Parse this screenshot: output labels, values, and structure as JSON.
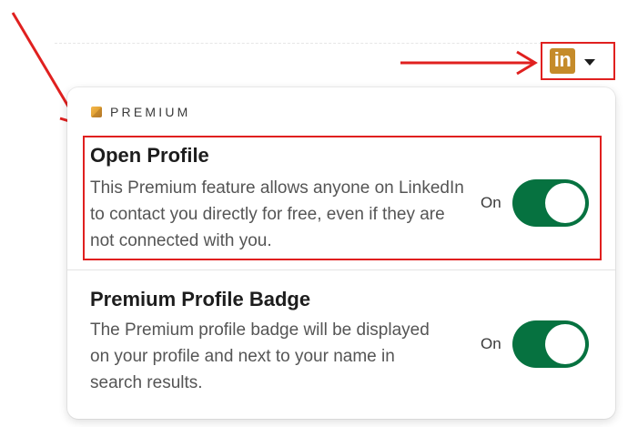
{
  "colors": {
    "annotation_red": "#e0201f",
    "premium_gold": "#c58b2a",
    "toggle_on": "#067240"
  },
  "trigger": {
    "logo_text": "in",
    "caret_icon": "chevron-down-icon"
  },
  "panel": {
    "section_label": "PREMIUM",
    "settings": [
      {
        "title": "Open Profile",
        "description": "This Premium feature allows anyone on LinkedIn to contact you directly for free, even if they are not connected with you.",
        "state_label": "On",
        "enabled": true
      },
      {
        "title": "Premium Profile Badge",
        "description": "The Premium profile badge will be displayed on your profile and next to your name in search results.",
        "state_label": "On",
        "enabled": true
      }
    ]
  }
}
